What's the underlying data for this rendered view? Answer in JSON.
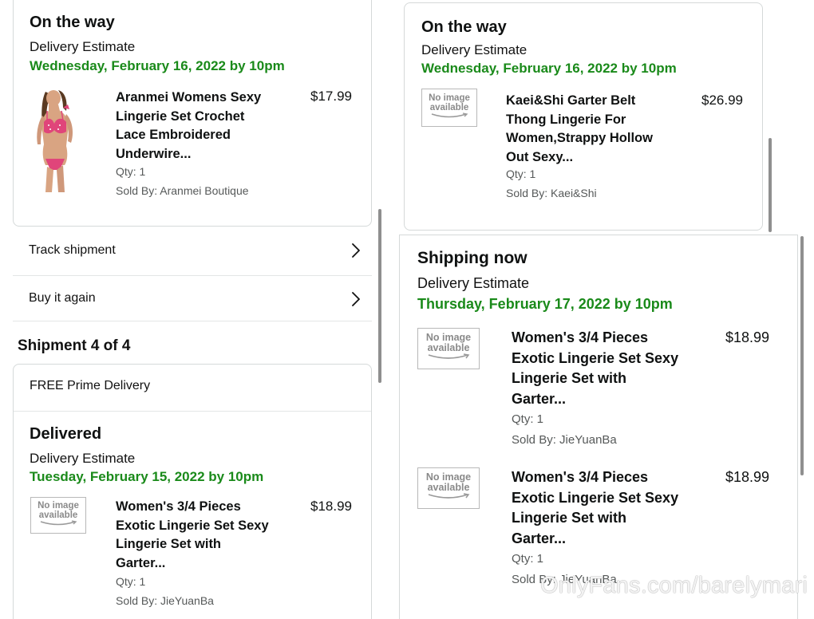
{
  "left": {
    "top_card": {
      "status": "On the way",
      "estimate_label": "Delivery Estimate",
      "date": "Wednesday, February 16, 2022 by 10pm",
      "item": {
        "name": [
          "Aranmei Womens Sexy",
          "Lingerie Set Crochet",
          "Lace Embroidered",
          "Underwire..."
        ],
        "price": "$17.99",
        "qty": "Qty: 1",
        "seller": "Sold By: Aranmei Boutique",
        "image": "product-photo"
      }
    },
    "actions": [
      {
        "label": "Track shipment",
        "icon": "chevron-right-icon"
      },
      {
        "label": "Buy it again",
        "icon": "chevron-right-icon"
      }
    ],
    "shipment_heading": "Shipment 4 of 4",
    "shipment_card": {
      "delivery_type": "FREE Prime Delivery",
      "status": "Delivered",
      "estimate_label": "Delivery Estimate",
      "date": "Tuesday, February 15, 2022 by 10pm",
      "item": {
        "name": [
          "Women's 3/4 Pieces",
          "Exotic Lingerie Set Sexy",
          "Lingerie Set with",
          "Garter..."
        ],
        "price": "$18.99",
        "qty": "Qty: 1",
        "seller": "Sold By: JieYuanBa",
        "image": [
          "No image",
          "available"
        ]
      }
    }
  },
  "right": {
    "top_card": {
      "status": "On the way",
      "estimate_label": "Delivery Estimate",
      "date": "Wednesday, February 16, 2022 by 10pm",
      "item": {
        "name": [
          "Kaei&Shi Garter Belt",
          "Thong Lingerie For",
          "Women,Strappy Hollow",
          "Out Sexy..."
        ],
        "price": "$26.99",
        "qty": "Qty: 1",
        "seller": "Sold By: Kaei&Shi",
        "image": [
          "No image",
          "available"
        ]
      }
    },
    "bottom_card": {
      "status": "Shipping now",
      "estimate_label": "Delivery Estimate",
      "date": "Thursday, February 17, 2022 by 10pm",
      "items": [
        {
          "name": [
            "Women's 3/4 Pieces",
            "Exotic Lingerie Set Sexy",
            "Lingerie Set with",
            "Garter..."
          ],
          "price": "$18.99",
          "qty": "Qty: 1",
          "seller": "Sold By: JieYuanBa",
          "image": [
            "No image",
            "available"
          ]
        },
        {
          "name": [
            "Women's 3/4 Pieces",
            "Exotic Lingerie Set Sexy",
            "Lingerie Set with",
            "Garter..."
          ],
          "price": "$18.99",
          "qty": "Qty: 1",
          "seller": "Sold By: JieYuanBa",
          "image": [
            "No image",
            "available"
          ]
        }
      ]
    }
  },
  "watermark": "OnlyFans.com/barelymari",
  "colors": {
    "date_green": "#1a8a1a",
    "border": "#d5d9d9",
    "muted_text": "#565959"
  }
}
